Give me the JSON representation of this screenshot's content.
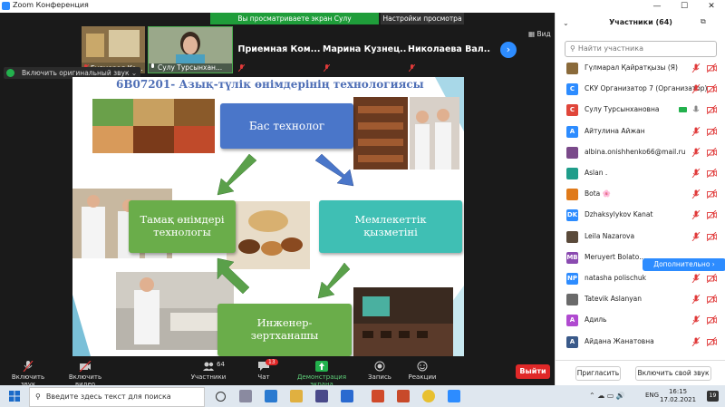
{
  "window": {
    "title": "Zoom Конференция",
    "controls": [
      "—",
      "☐",
      "✕"
    ]
  },
  "banner": {
    "viewing_text": "Вы просматриваете экран Сулу Турсынхановна",
    "view_settings": "Настройки просмотра ⌄"
  },
  "video_strip": {
    "tiles": [
      {
        "name": "Гүлмарал Қа..."
      },
      {
        "name": "Сулу Турсынхан..."
      },
      {
        "name": "Приемная  Ком..."
      },
      {
        "name": "Марина  Кузнец..."
      },
      {
        "name": "Николаева  Вал..."
      }
    ],
    "next_glyph": "›",
    "view_label": "Вид"
  },
  "original_sound": "Включить оригинальный звук",
  "slide": {
    "title": "6В07201- Азық-түлік өнімдерінің технологиясы",
    "boxes": {
      "top": "Бас технолог",
      "left_1": "Тамақ өнімдері",
      "left_2": "технологы",
      "right_1": "Мемлекеттік",
      "right_2": "қызметіні",
      "bottom_1": "Инженер-",
      "bottom_2": "зертханашы"
    },
    "colors": {
      "top": "#4a76c9",
      "left": "#6aad4a",
      "right": "#3fbfb4",
      "bottom": "#6aad4a"
    }
  },
  "toolbar": {
    "unmute": "Включить звук",
    "video": "Включить видео",
    "participants": "Участники",
    "participants_count": "64",
    "chat": "Чат",
    "chat_badge": "13",
    "share": "Демонстрация экрана",
    "record": "Запись",
    "reactions": "Реакции",
    "leave": "Выйти"
  },
  "panel": {
    "header": "Участники (64)",
    "search_placeholder": "Найти участника",
    "more_button": "Дополнительно ›",
    "invite": "Пригласить",
    "unmute_self": "Включить свой звук",
    "participants": [
      {
        "initials": "",
        "name": "Гүлмарал Қайратқызы (Я)",
        "color": "#8a6a3a"
      },
      {
        "initials": "С",
        "name": "СКУ Организатор 7 (Организатор)",
        "color": "#2d8cff"
      },
      {
        "initials": "С",
        "name": "Сулу Турсынхановна",
        "color": "#e0463a"
      },
      {
        "initials": "А",
        "name": "Айтулина Айжан",
        "color": "#2d8cff"
      },
      {
        "initials": "",
        "name": "albina.onishhenko66@mail.ru",
        "color": "#7a4a8a"
      },
      {
        "initials": "",
        "name": "Aslan .",
        "color": "#1f9d8a"
      },
      {
        "initials": "",
        "name": "Bota 🌸",
        "color": "#e07a1a"
      },
      {
        "initials": "DK",
        "name": "Dzhaksylykov Kanat",
        "color": "#2d8cff"
      },
      {
        "initials": "",
        "name": "Leila Nazarova",
        "color": "#5a4a3a"
      },
      {
        "initials": "MB",
        "name": "Meruyert Bolato...",
        "color": "#8a4ab0"
      },
      {
        "initials": "NP",
        "name": "natasha polischuk",
        "color": "#2d8cff"
      },
      {
        "initials": "",
        "name": "Tatevik Aslanyan",
        "color": "#6a6a6a"
      },
      {
        "initials": "А",
        "name": "Адиль",
        "color": "#b04ad0"
      },
      {
        "initials": "А",
        "name": "Айдана Жанатовна",
        "color": "#3a5a8a"
      }
    ]
  },
  "taskbar": {
    "search_placeholder": "Введите здесь текст для поиска",
    "lang": "ENG",
    "time": "16:15",
    "date": "17.02.2021"
  }
}
